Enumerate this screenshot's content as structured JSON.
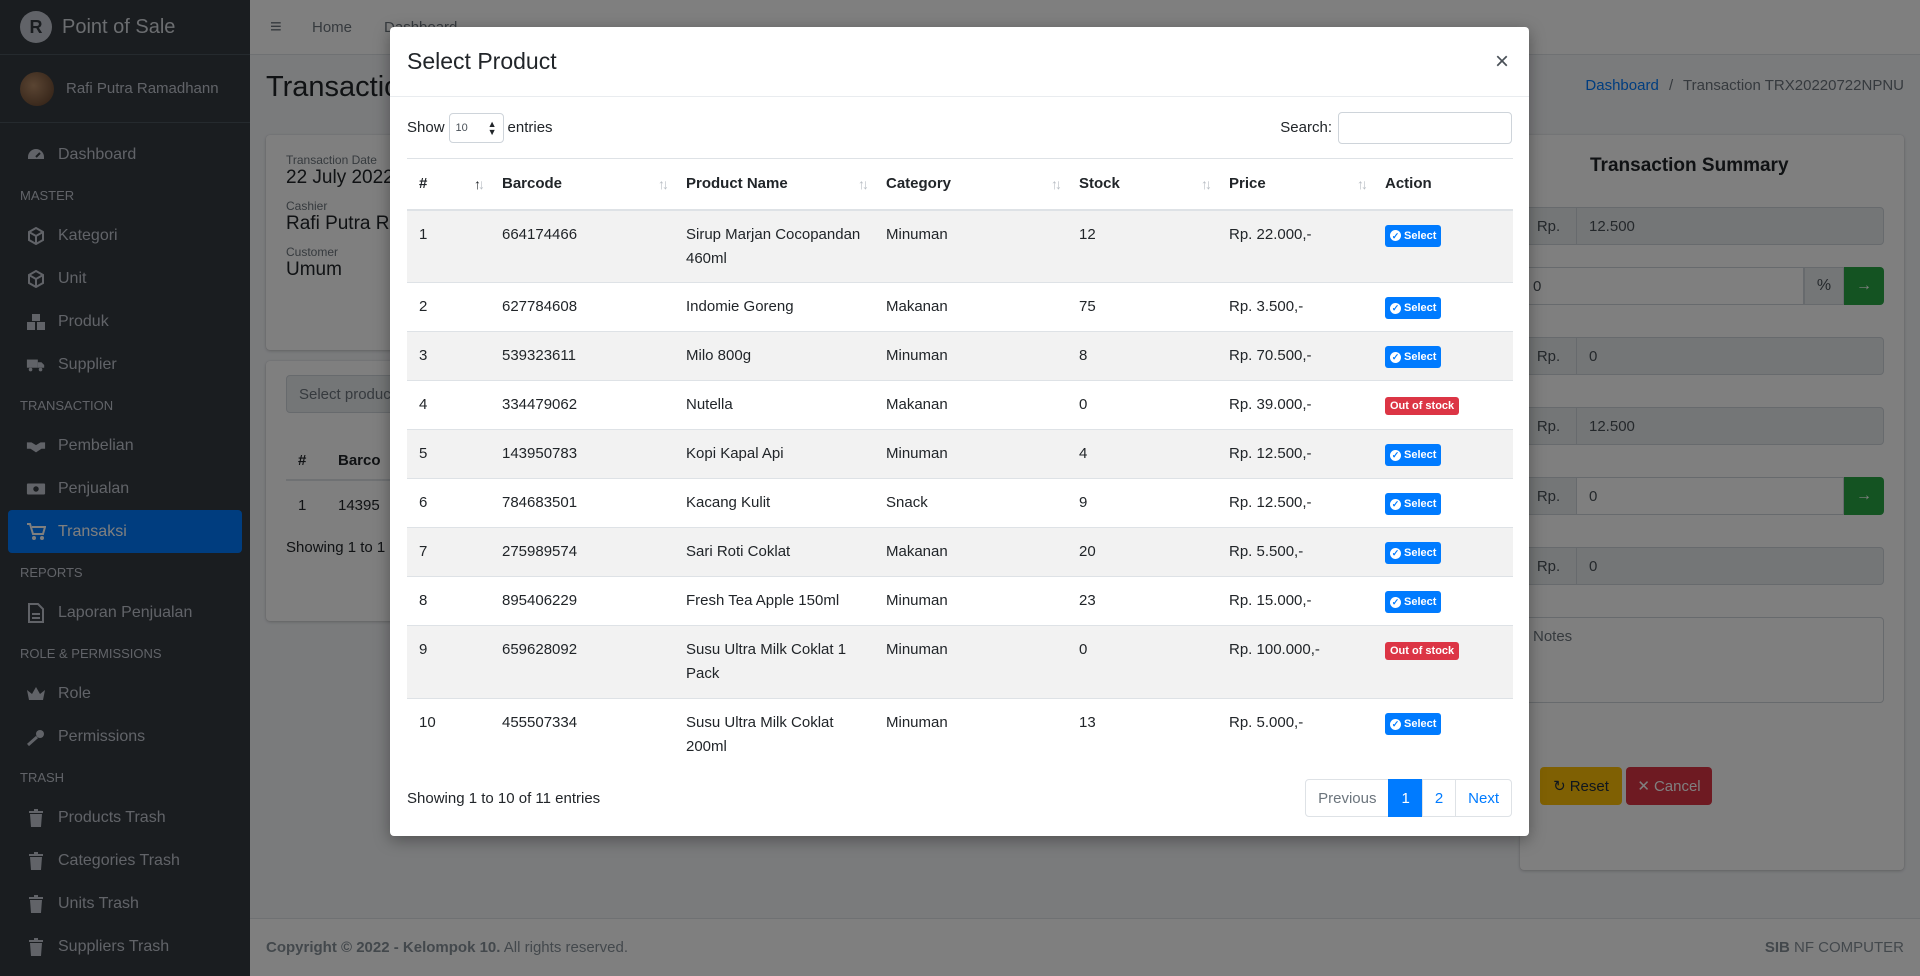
{
  "app": {
    "brand": "Point of Sale",
    "user": "Rafi Putra Ramadhann"
  },
  "sidebar": {
    "items": [
      {
        "label": "Dashboard",
        "icon": "dashboard-icon"
      },
      {
        "header": "MASTER"
      },
      {
        "label": "Kategori",
        "icon": "box-icon"
      },
      {
        "label": "Unit",
        "icon": "box-icon"
      },
      {
        "label": "Produk",
        "icon": "boxes-icon"
      },
      {
        "label": "Supplier",
        "icon": "truck-icon"
      },
      {
        "header": "TRANSACTION"
      },
      {
        "label": "Pembelian",
        "icon": "handshake-icon"
      },
      {
        "label": "Penjualan",
        "icon": "money-icon"
      },
      {
        "label": "Transaksi",
        "icon": "cart-icon",
        "active": true
      },
      {
        "header": "REPORTS"
      },
      {
        "label": "Laporan Penjualan",
        "icon": "file-icon"
      },
      {
        "header": "ROLE & PERMISSIONS"
      },
      {
        "label": "Role",
        "icon": "crown-icon"
      },
      {
        "label": "Permissions",
        "icon": "key-icon"
      },
      {
        "header": "TRASH"
      },
      {
        "label": "Products Trash",
        "icon": "trash-icon"
      },
      {
        "label": "Categories Trash",
        "icon": "trash-icon"
      },
      {
        "label": "Units Trash",
        "icon": "trash-icon"
      },
      {
        "label": "Suppliers Trash",
        "icon": "trash-icon"
      }
    ]
  },
  "topnav": {
    "home": "Home",
    "dashboard": "Dashboard"
  },
  "page": {
    "title": "Transaction",
    "breadcrumb": {
      "link": "Dashboard",
      "separator": "/",
      "current": "Transaction TRX20220722NPNU"
    },
    "info": {
      "date_label": "Transaction Date",
      "date_value": "22 July 2022,",
      "cashier_label": "Cashier",
      "cashier_value": "Rafi Putra Ra",
      "customer_label": "Customer",
      "customer_value": "Umum"
    },
    "select_product_placeholder": "Select produc",
    "mini_table": {
      "col1": "#",
      "col2": "Barco",
      "row_no": "1",
      "row_barcode": "14395",
      "showing": "Showing 1 to 1 o"
    },
    "summary": {
      "title": "Transaction Summary",
      "rows": [
        {
          "prefix": "Rp.",
          "value": "12.500"
        },
        {
          "prefix": "",
          "value": "0",
          "suffix": "%"
        },
        {
          "prefix": "Rp.",
          "value": "0"
        },
        {
          "prefix": "Rp.",
          "value": "12.500"
        },
        {
          "prefix": "Rp.",
          "value": "0"
        },
        {
          "prefix": "Rp.",
          "value": "0"
        }
      ],
      "notes_placeholder": "Notes",
      "reset_label": "Reset",
      "cancel_label": "Cancel"
    }
  },
  "footer": {
    "copyright": "Copyright © 2022 - Kelompok 10.",
    "rights": "All rights reserved.",
    "brand_bold": "SIB",
    "brand_rest": "NF COMPUTER"
  },
  "modal": {
    "title": "Select Product",
    "close": "×",
    "show_label": "Show",
    "entries_value": "10",
    "entries_label": "entries",
    "search_label": "Search:",
    "columns": [
      "#",
      "Barcode",
      "Product Name",
      "Category",
      "Stock",
      "Price",
      "Action"
    ],
    "rows": [
      {
        "no": "1",
        "barcode": "664174466",
        "name": "Sirup Marjan Cocopandan 460ml",
        "category": "Minuman",
        "stock": "12",
        "price": "Rp. 22.000,-",
        "action": "Select"
      },
      {
        "no": "2",
        "barcode": "627784608",
        "name": "Indomie Goreng",
        "category": "Makanan",
        "stock": "75",
        "price": "Rp. 3.500,-",
        "action": "Select"
      },
      {
        "no": "3",
        "barcode": "539323611",
        "name": "Milo 800g",
        "category": "Minuman",
        "stock": "8",
        "price": "Rp. 70.500,-",
        "action": "Select"
      },
      {
        "no": "4",
        "barcode": "334479062",
        "name": "Nutella",
        "category": "Makanan",
        "stock": "0",
        "price": "Rp. 39.000,-",
        "action": "Out of stock"
      },
      {
        "no": "5",
        "barcode": "143950783",
        "name": "Kopi Kapal Api",
        "category": "Minuman",
        "stock": "4",
        "price": "Rp. 12.500,-",
        "action": "Select"
      },
      {
        "no": "6",
        "barcode": "784683501",
        "name": "Kacang Kulit",
        "category": "Snack",
        "stock": "9",
        "price": "Rp. 12.500,-",
        "action": "Select"
      },
      {
        "no": "7",
        "barcode": "275989574",
        "name": "Sari Roti Coklat",
        "category": "Makanan",
        "stock": "20",
        "price": "Rp. 5.500,-",
        "action": "Select"
      },
      {
        "no": "8",
        "barcode": "895406229",
        "name": "Fresh Tea Apple 150ml",
        "category": "Minuman",
        "stock": "23",
        "price": "Rp. 15.000,-",
        "action": "Select"
      },
      {
        "no": "9",
        "barcode": "659628092",
        "name": "Susu Ultra Milk Coklat 1 Pack",
        "category": "Minuman",
        "stock": "0",
        "price": "Rp. 100.000,-",
        "action": "Out of stock"
      },
      {
        "no": "10",
        "barcode": "455507334",
        "name": "Susu Ultra Milk Coklat 200ml",
        "category": "Minuman",
        "stock": "13",
        "price": "Rp. 5.000,-",
        "action": "Select"
      }
    ],
    "info": "Showing 1 to 10 of 11 entries",
    "pagination": {
      "previous": "Previous",
      "pages": [
        "1",
        "2"
      ],
      "next": "Next"
    }
  }
}
